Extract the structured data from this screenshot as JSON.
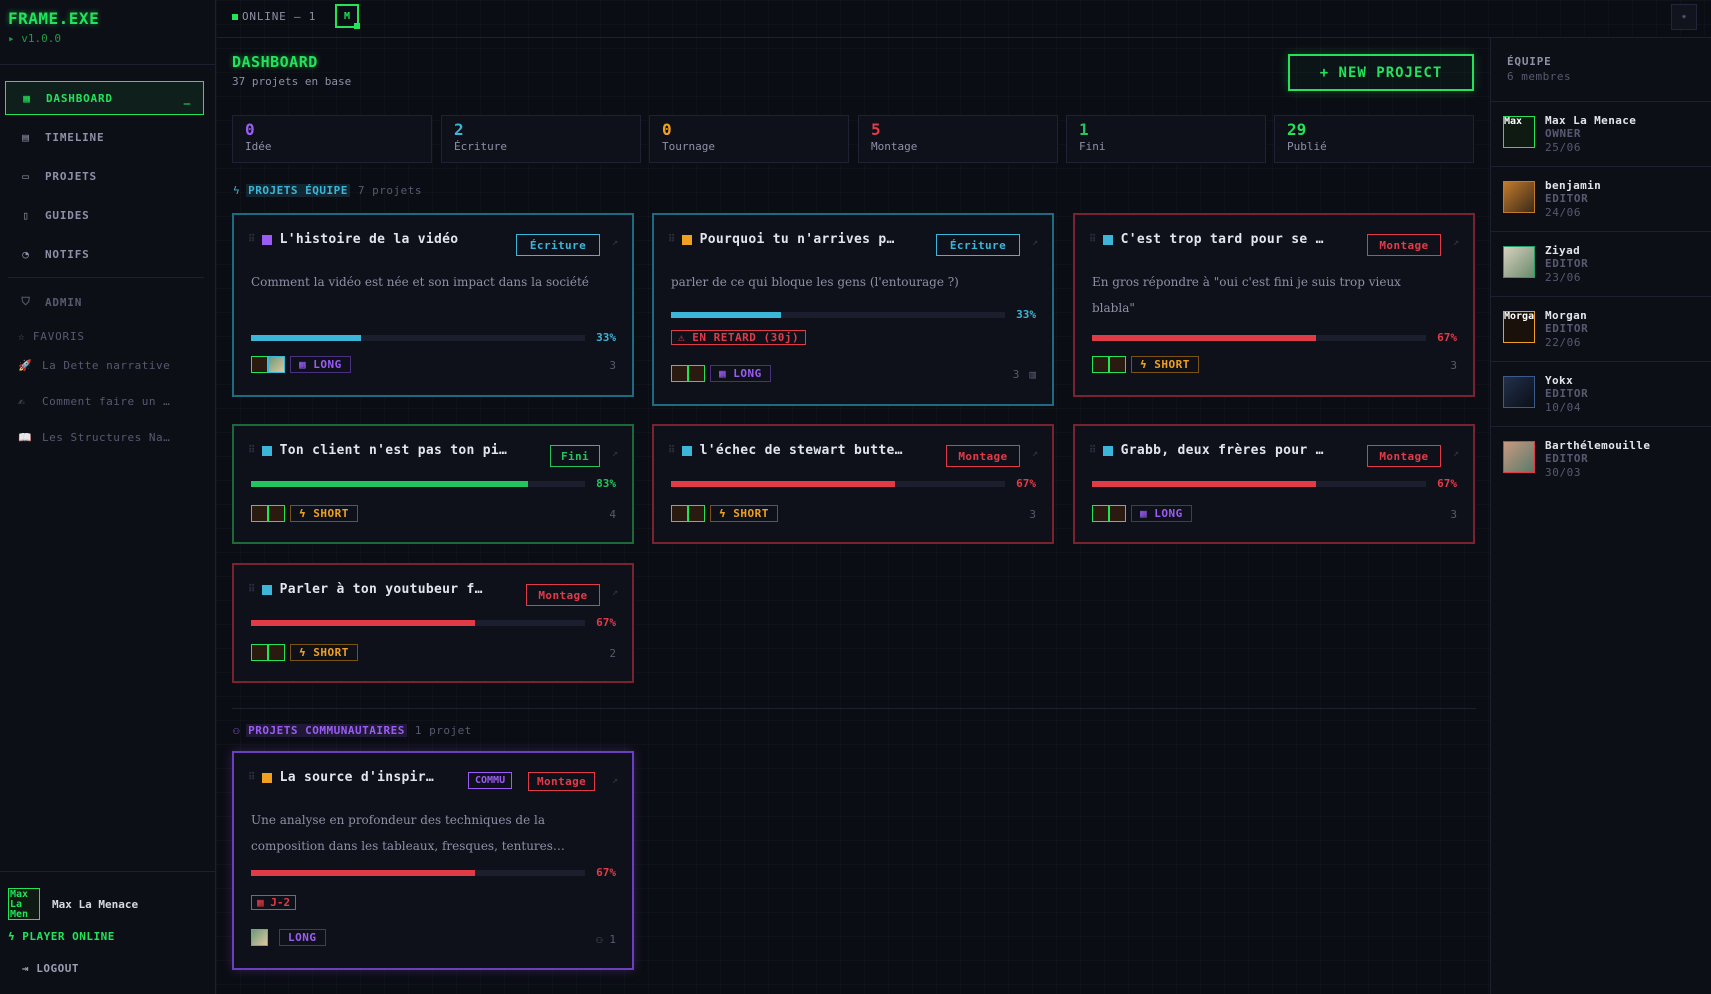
{
  "app": {
    "logo": "FRAME.EXE",
    "version": "▸ v1.0.0"
  },
  "nav": [
    {
      "label": "DASHBOARD",
      "icon": "grid-icon",
      "active": true
    },
    {
      "label": "TIMELINE",
      "icon": "calendar-icon"
    },
    {
      "label": "PROJETS",
      "icon": "folder-icon"
    },
    {
      "label": "GUIDES",
      "icon": "book-icon"
    },
    {
      "label": "NOTIFS",
      "icon": "bell-icon"
    },
    {
      "label": "ADMIN",
      "icon": "shield-icon"
    }
  ],
  "favorites": {
    "title": "☆ FAVORIS",
    "items": [
      {
        "icon": "🚀",
        "label": "La Dette narrative"
      },
      {
        "icon": "✍",
        "label": "Comment faire un …"
      },
      {
        "icon": "📖",
        "label": "Les Structures Na…"
      }
    ]
  },
  "user": {
    "avatar_text": "Max La Men",
    "name": "Max La Menace",
    "status": "PLAYER ONLINE",
    "logout": "LOGOUT"
  },
  "topbar": {
    "online": "ONLINE — 1",
    "online_avatar": "M",
    "settings_icon": "✷"
  },
  "main": {
    "title": "DASHBOARD",
    "subtitle": "37 projets en base",
    "new_button": "+ NEW PROJECT"
  },
  "stats": [
    {
      "value": "0",
      "label": "Idée",
      "color": "#9b5cf6"
    },
    {
      "value": "2",
      "label": "Écriture",
      "color": "#3bb6d8"
    },
    {
      "value": "0",
      "label": "Tournage",
      "color": "#f0a020"
    },
    {
      "value": "5",
      "label": "Montage",
      "color": "#e23b48"
    },
    {
      "value": "1",
      "label": "Fini",
      "color": "#22c55e"
    },
    {
      "value": "29",
      "label": "Publié",
      "color": "#22e35a"
    }
  ],
  "team_section": {
    "title": "PROJETS ÉQUIPE",
    "count": "7 projets"
  },
  "community_section": {
    "title": "PROJETS COMMUNAUTAIRES",
    "count": "1 projet"
  },
  "team_projects": [
    {
      "title": "L'histoire de la vidéo",
      "status": "Écriture",
      "desc": "Comment la vidéo est née et son impact dans la société",
      "progress": 33,
      "pct": "33%",
      "format": "LONG",
      "count": "3",
      "cat_color": "#9b5cf6"
    },
    {
      "title": "Pourquoi tu n'arrives p…",
      "status": "Écriture",
      "desc": "parler de ce qui bloque les gens (l'entourage ?)",
      "progress": 33,
      "pct": "33%",
      "late": "⚠ EN RETARD (30j)",
      "format": "LONG",
      "count": "3",
      "cat_color": "#f0a020"
    },
    {
      "title": "C'est trop tard pour se …",
      "status": "Montage",
      "desc": "En gros répondre à \"oui c'est fini je suis trop vieux blabla\"",
      "progress": 67,
      "pct": "67%",
      "format": "SHORT",
      "count": "3",
      "cat_color": "#3bb6d8"
    },
    {
      "title": "Ton client n'est pas ton pi…",
      "status": "Fini",
      "desc": "",
      "progress": 83,
      "pct": "83%",
      "format": "SHORT",
      "count": "4",
      "cat_color": "#3bb6d8"
    },
    {
      "title": "l'échec de stewart butte…",
      "status": "Montage",
      "desc": "",
      "progress": 67,
      "pct": "67%",
      "format": "SHORT",
      "count": "3",
      "cat_color": "#3bb6d8"
    },
    {
      "title": "Grabb, deux frères pour …",
      "status": "Montage",
      "desc": "",
      "progress": 67,
      "pct": "67%",
      "format": "LONG",
      "count": "3",
      "cat_color": "#3bb6d8"
    },
    {
      "title": "Parler à ton youtubeur f…",
      "status": "Montage",
      "desc": "",
      "progress": 67,
      "pct": "67%",
      "format": "SHORT",
      "count": "2",
      "cat_color": "#3bb6d8"
    }
  ],
  "community_project": {
    "title": "La source d'inspir…",
    "commu": "COMMU",
    "status": "Montage",
    "desc": "Une analyse en profondeur des techniques de la composition dans les tableaux, fresques, tentures…",
    "progress": 67,
    "pct": "67%",
    "deadline": "▦ J-2",
    "format": "LONG",
    "count": "1",
    "cat_color": "#f0a020"
  },
  "team": {
    "title": "ÉQUIPE",
    "subtitle": "6 membres",
    "members": [
      {
        "name": "Max La Menace",
        "role": "OWNER",
        "date": "25/06",
        "avatar_text": "Max"
      },
      {
        "name": "benjamin",
        "role": "EDITOR",
        "date": "24/06",
        "avatar_text": ""
      },
      {
        "name": "Ziyad",
        "role": "EDITOR",
        "date": "23/06",
        "avatar_text": ""
      },
      {
        "name": "Morgan",
        "role": "EDITOR",
        "date": "22/06",
        "avatar_text": "Morga"
      },
      {
        "name": "Yokx",
        "role": "EDITOR",
        "date": "10/04",
        "avatar_text": ""
      },
      {
        "name": "Barthélemouille",
        "role": "EDITOR",
        "date": "30/03",
        "avatar_text": ""
      }
    ]
  },
  "colors": {
    "accent": "#22e35a",
    "ecriture": "#3bb6d8",
    "montage": "#e23b48",
    "fini": "#22c55e",
    "commu": "#9b5cf6",
    "short": "#f0a020"
  }
}
